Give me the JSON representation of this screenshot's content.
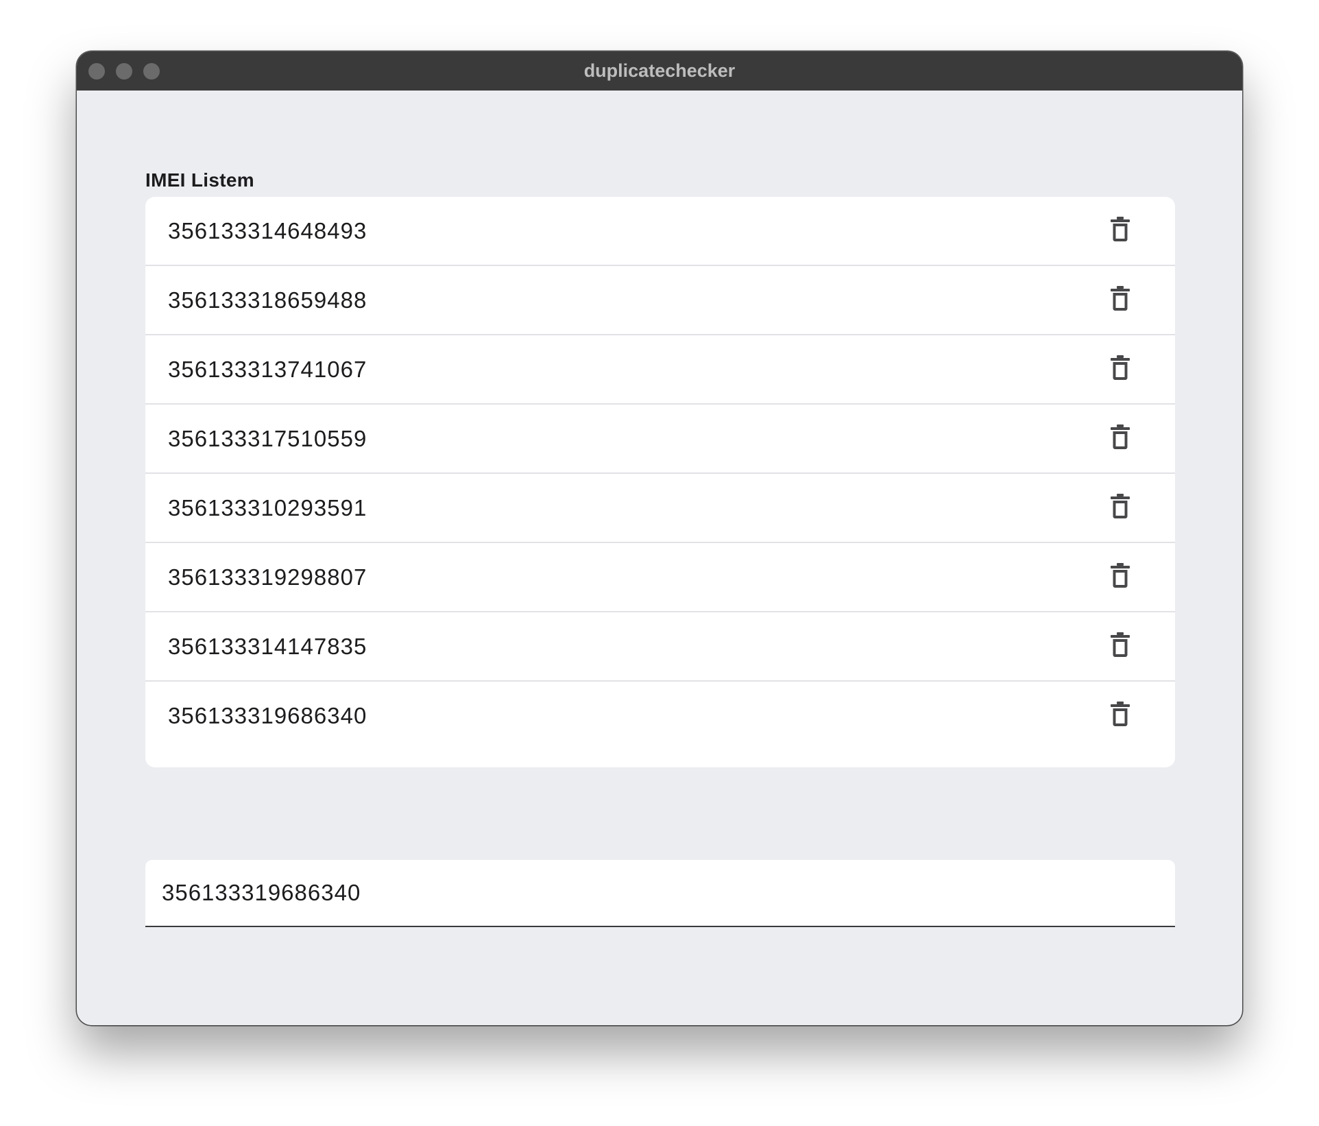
{
  "window": {
    "title": "duplicatechecker"
  },
  "list": {
    "label": "IMEI Listem",
    "items": [
      {
        "value": "356133314648493"
      },
      {
        "value": "356133318659488"
      },
      {
        "value": "356133313741067"
      },
      {
        "value": "356133317510559"
      },
      {
        "value": "356133310293591"
      },
      {
        "value": "356133319298807"
      },
      {
        "value": "356133314147835"
      },
      {
        "value": "356133319686340"
      }
    ],
    "delete_icon": "trash-icon"
  },
  "input": {
    "value": "356133319686340"
  },
  "colors": {
    "background": "#ecedf1",
    "titlebar": "#3a3a3a",
    "card": "#ffffff",
    "icon": "#48484a"
  }
}
